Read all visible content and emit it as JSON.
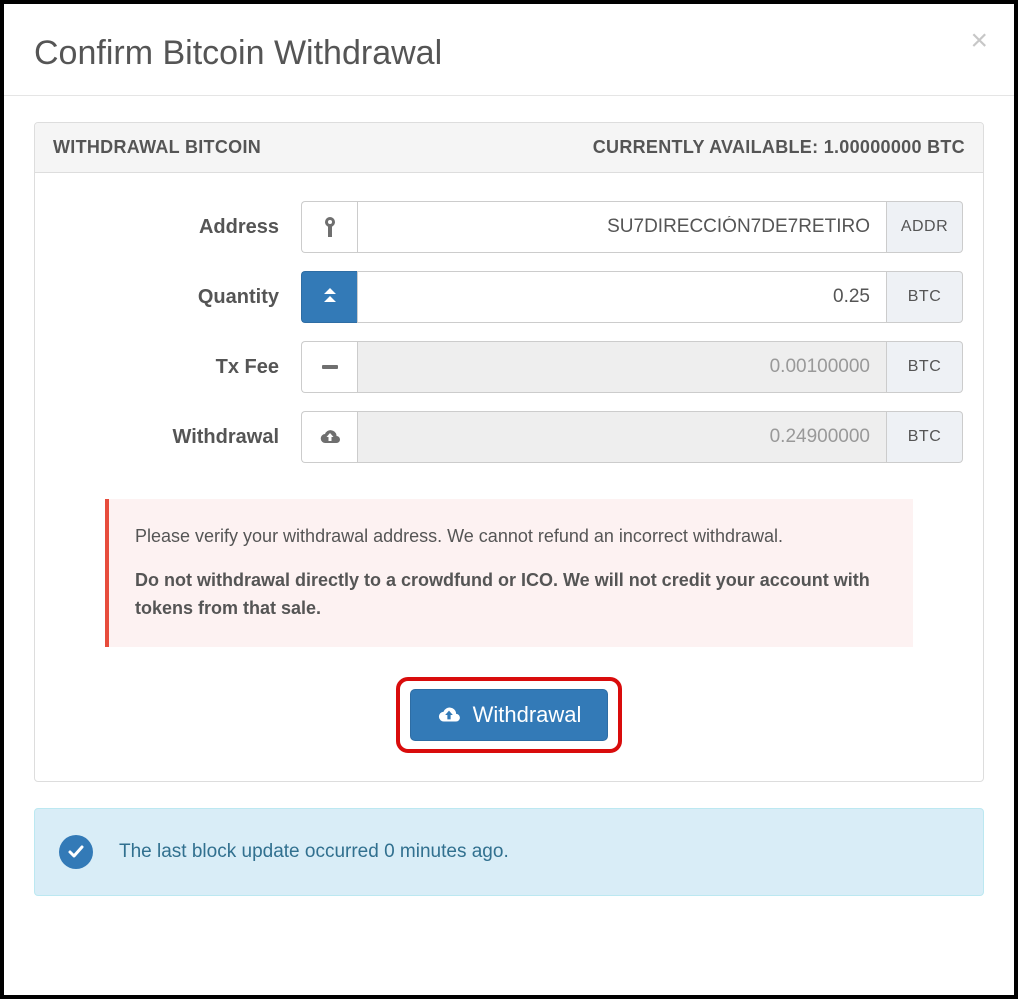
{
  "modal": {
    "title": "Confirm Bitcoin Withdrawal"
  },
  "panel": {
    "header_left": "WITHDRAWAL BITCOIN",
    "header_right": "CURRENTLY AVAILABLE: 1.00000000 BTC"
  },
  "form": {
    "address": {
      "label": "Address",
      "value": "SU7DIRECCIÓN7DE7RETIRO",
      "unit": "ADDR"
    },
    "quantity": {
      "label": "Quantity",
      "value": "0.25",
      "unit": "BTC"
    },
    "txfee": {
      "label": "Tx Fee",
      "value": "0.00100000",
      "unit": "BTC"
    },
    "withdrawal": {
      "label": "Withdrawal",
      "value": "0.24900000",
      "unit": "BTC"
    }
  },
  "warning": {
    "line1": "Please verify your withdrawal address. We cannot refund an incorrect withdrawal.",
    "line2": "Do not withdrawal directly to a crowdfund or ICO. We will not credit your account with tokens from that sale."
  },
  "button": {
    "label": "Withdrawal"
  },
  "info": {
    "text": "The last block update occurred 0 minutes ago."
  }
}
